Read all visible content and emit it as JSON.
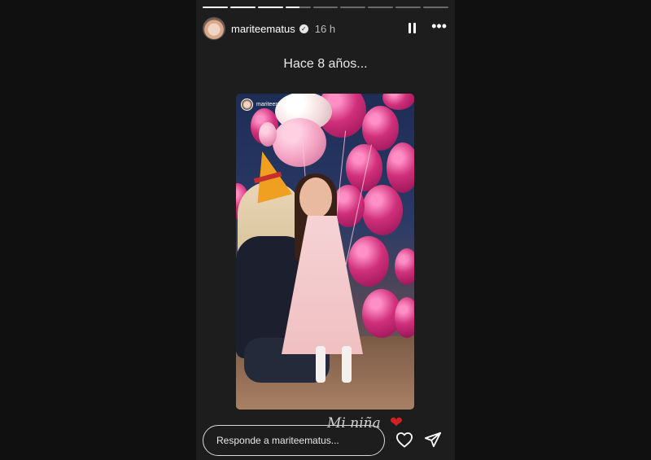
{
  "story": {
    "username": "mariteematus",
    "time": "16 h",
    "verified_icon": "verified-badge-icon",
    "progress": {
      "total_segments": 9,
      "completed_segments": 3,
      "current_segment_fraction": 0.55
    },
    "caption": "Hace 8 años...",
    "photo": {
      "username": "mariteematus",
      "description_icon": "birthday-photo"
    },
    "sticker_text": "Mi niña",
    "sticker_emoji": "❤️",
    "reply_placeholder": "Responde a mariteematus..."
  },
  "icons": {
    "pause": "pause-icon",
    "more": "more-options-icon",
    "like": "heart-icon",
    "share": "send-icon"
  },
  "colors": {
    "background": "#101010",
    "story_background": "#1d1d1d",
    "text": "#ffffff",
    "heart": "#d42020"
  }
}
